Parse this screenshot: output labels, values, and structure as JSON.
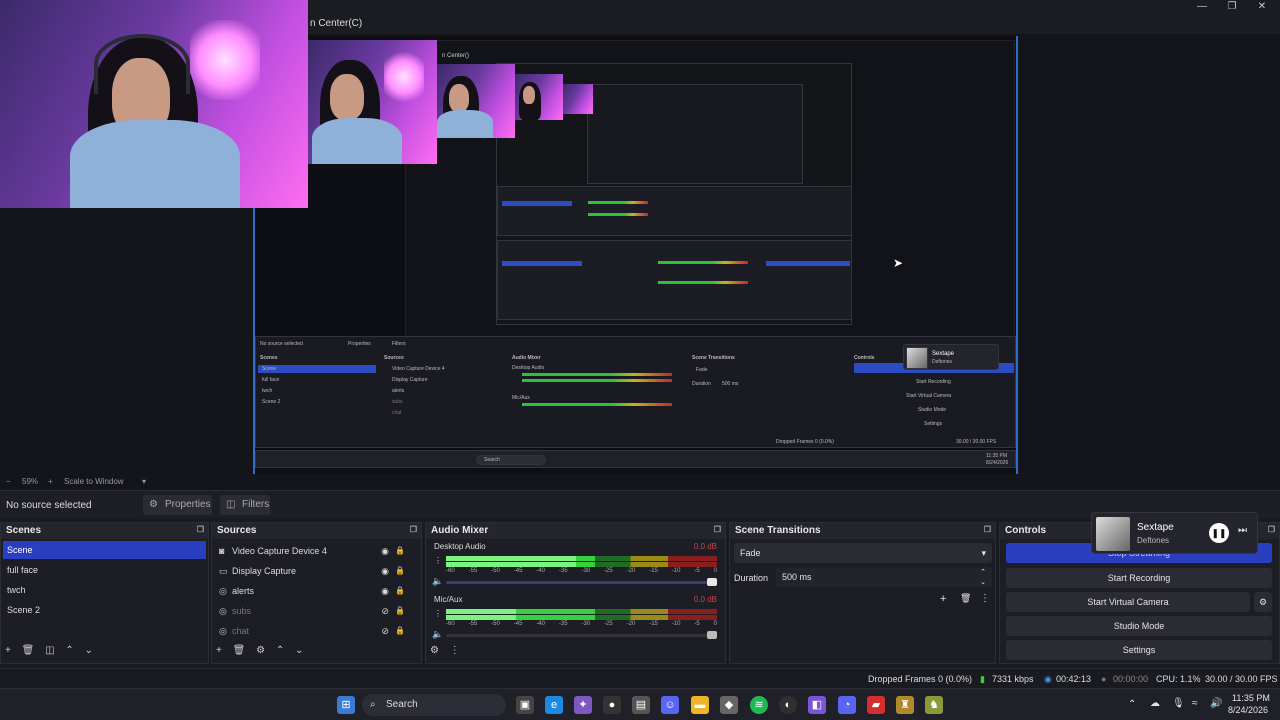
{
  "window": {
    "title_fragment": "n Center(C)",
    "min": "—",
    "max": "❐",
    "close": "✕"
  },
  "preview": {
    "zoom": "59%",
    "zoom_minus": "−",
    "zoom_plus": "+",
    "scale_mode": "Scale to Window"
  },
  "source_bar": {
    "status": "No source selected",
    "properties": "Properties",
    "filters": "Filters"
  },
  "scenes": {
    "title": "Scenes",
    "items": [
      "Scene",
      "full face",
      "twch",
      "Scene 2"
    ],
    "selected_index": 0
  },
  "sources": {
    "title": "Sources",
    "items": [
      {
        "name": "Video Capture Device 4",
        "icon": "camera-icon",
        "visible": true
      },
      {
        "name": "Display Capture",
        "icon": "monitor-icon",
        "visible": true
      },
      {
        "name": "alerts",
        "icon": "globe-icon",
        "visible": true
      },
      {
        "name": "subs",
        "icon": "globe-icon",
        "visible": false
      },
      {
        "name": "chat",
        "icon": "globe-icon",
        "visible": false
      }
    ]
  },
  "audio_mixer": {
    "title": "Audio Mixer",
    "tracks": [
      {
        "name": "Desktop Audio",
        "db": "0.0 dB",
        "level": 0.48,
        "volume": 1.0
      },
      {
        "name": "Mic/Aux",
        "db": "0.0 dB",
        "level": 0.26,
        "volume": 1.0
      }
    ],
    "scale": [
      "-60",
      "-55",
      "-50",
      "-45",
      "-40",
      "-35",
      "-30",
      "-25",
      "-20",
      "-15",
      "-10",
      "-5",
      "0"
    ]
  },
  "transitions": {
    "title": "Scene Transitions",
    "selected": "Fade",
    "duration_label": "Duration",
    "duration_value": "500 ms"
  },
  "controls": {
    "title": "Controls",
    "buttons": [
      "Stop Streaming",
      "Start Recording",
      "Start Virtual Camera",
      "Studio Mode",
      "Settings"
    ]
  },
  "media": {
    "title": "Sextape",
    "artist": "Deftones"
  },
  "status": {
    "dropped": "Dropped Frames 0 (0.0%)",
    "bitrate": "7331 kbps",
    "stream_time": "00:42:13",
    "rec_time": "00:00:00",
    "cpu": "CPU: 1.1%",
    "fps": "30.00 / 30.00 FPS"
  },
  "taskbar": {
    "search": "Search",
    "time": "11:35 PM",
    "date": "8/24/2026"
  },
  "colors": {
    "accent": "#2a3fc0",
    "canvas_border": "#2d6dcc",
    "meter_green": "#36d13f"
  }
}
